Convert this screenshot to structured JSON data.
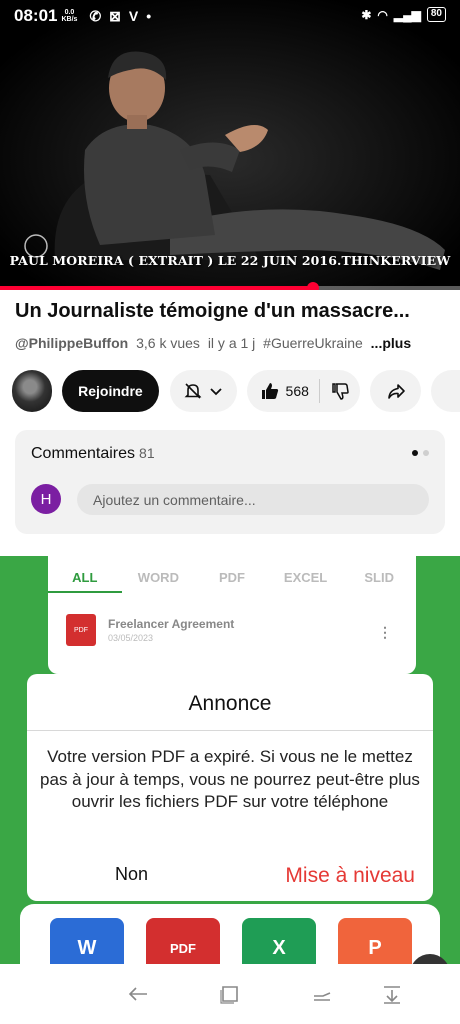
{
  "status_bar": {
    "time": "08:01",
    "speed_value": "0.0",
    "speed_unit": "KB/s",
    "battery": "80"
  },
  "video": {
    "caption": "PAUL MOREIRA ( EXTRAIT ) LE 22 JUIN 2016.THINKERVIEW",
    "progress": 0.68
  },
  "details": {
    "title": "Un Journaliste témoigne d'un massacre...",
    "channel": "@PhilippeBuffon",
    "views": "3,6 k vues",
    "age": "il y a 1 j",
    "hashtag": "#GuerreUkraine",
    "more": "...plus"
  },
  "actions": {
    "join_label": "Rejoindre",
    "like_count": "568"
  },
  "comments": {
    "title": "Commentaires",
    "count": "81",
    "user_initial": "H",
    "input_placeholder": "Ajoutez un commentaire..."
  },
  "ad": {
    "tabs": [
      "ALL",
      "WORD",
      "PDF",
      "EXCEL",
      "SLID"
    ],
    "doc_title": "Freelancer Agreement",
    "doc_date": "03/05/2023",
    "doc_icon_label": "PDF",
    "dialog": {
      "title": "Annonce",
      "message": "Votre version PDF a expiré. Si vous ne le mettez pas à jour à temps, vous ne pourrez peut-être plus ouvrir les fichiers PDF sur votre téléphone",
      "no_label": "Non",
      "upgrade_label": "Mise à niveau"
    },
    "tiles": [
      "W",
      "PDF",
      "X",
      "P"
    ]
  },
  "colors": {
    "accent_red": "#ff0033",
    "ad_green": "#3aa745",
    "upgrade_red": "#e53935",
    "avatar_purple": "#7b1fa2"
  },
  "icons": [
    "whatsapp-icon",
    "notification-icon",
    "vpn-icon",
    "bluetooth-icon",
    "wifi-icon",
    "signal-icon",
    "bell-off-icon",
    "chevron-down-icon",
    "thumbs-up-icon",
    "thumbs-down-icon",
    "share-icon",
    "back-icon",
    "home-icon",
    "recents-icon",
    "hide-nav-icon"
  ]
}
